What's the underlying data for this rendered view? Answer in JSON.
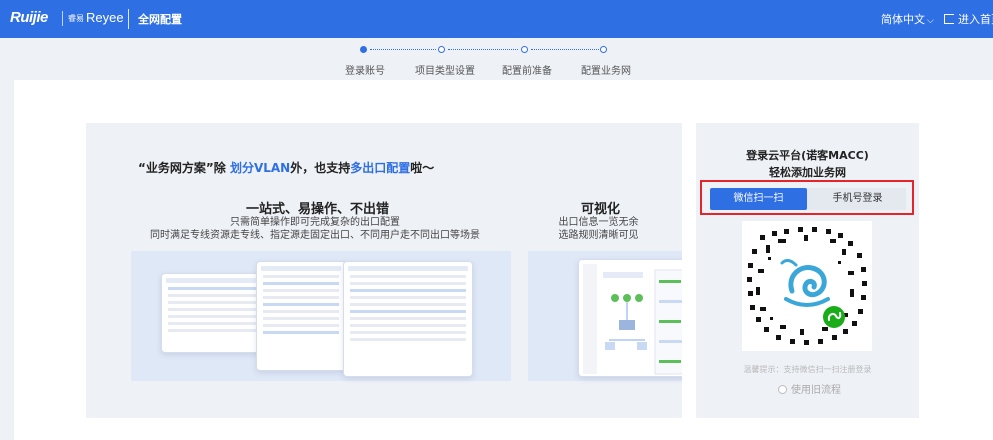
{
  "header": {
    "brand": "Ruijie",
    "sub_brand_mini": "睿易",
    "sub_brand": "Reyee",
    "title": "全网配置",
    "language": "简体中文",
    "home_link": "进入首页"
  },
  "steps": [
    {
      "label": "登录账号",
      "active": true
    },
    {
      "label": "项目类型设置",
      "active": false
    },
    {
      "label": "配置前准备",
      "active": false
    },
    {
      "label": "配置业务网",
      "active": false
    }
  ],
  "promo": {
    "tagline_pre": "“业务网方案”除 ",
    "tagline_hl1": "划分VLAN",
    "tagline_mid": "外，也支持",
    "tagline_hl2": "多出口配置",
    "tagline_post": "啦～",
    "feature1": {
      "title": "一站式、易操作、不出错",
      "desc_line1": "只需简单操作即可完成复杂的出口配置",
      "desc_line2": "同时满足专线资源走专线、指定源走固定出口、不同用户走不同出口等场景"
    },
    "feature2": {
      "title": "可视化",
      "desc_line1": "出口信息一览无余",
      "desc_line2": "选路规则清晰可见"
    }
  },
  "login": {
    "title_line1": "登录云平台(诺客MACC)",
    "title_line2": "轻松添加业务网",
    "tab_wechat": "微信扫一扫",
    "tab_phone": "手机号登录",
    "hint": "温馨提示：支持微信扫一扫注册登录",
    "old_flow": "使用旧流程"
  },
  "colors": {
    "primary": "#2f6fe4",
    "highlight_box": "#e5252c",
    "qr_accent": "#3aa7d8",
    "miniprogram_badge": "#1aad19"
  }
}
